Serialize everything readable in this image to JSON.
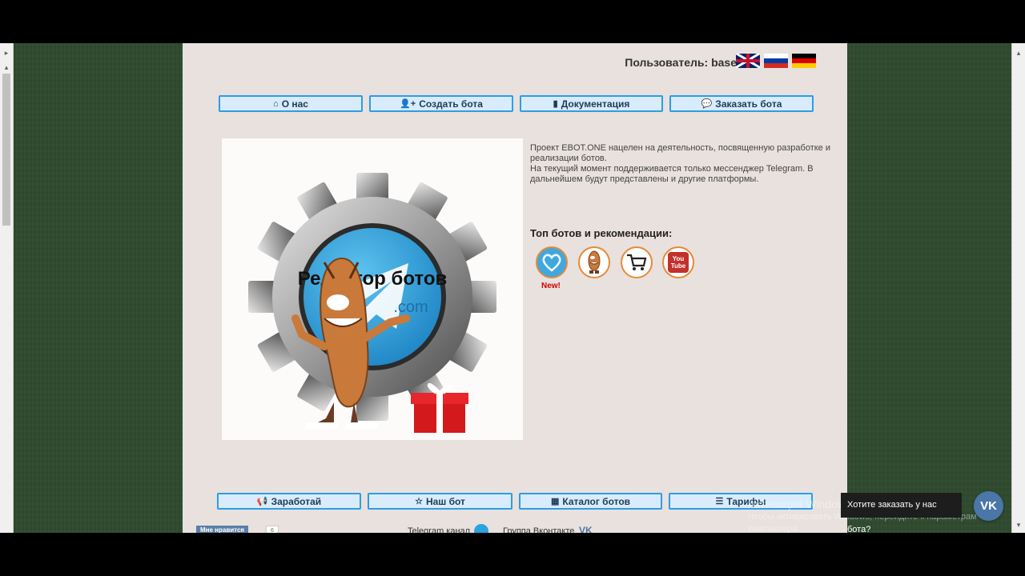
{
  "header": {
    "user_label": "Пользователь: base"
  },
  "nav_top": [
    {
      "label": "О нас",
      "icon": "home-icon"
    },
    {
      "label": "Создать бота",
      "icon": "user-plus-icon"
    },
    {
      "label": "Документация",
      "icon": "book-icon"
    },
    {
      "label": "Заказать бота",
      "icon": "chat-icon"
    }
  ],
  "hero": {
    "title": "Редактор ботов",
    "domain_text": ".com"
  },
  "intro": {
    "line1": "Проект EBOT.ONE нацелен на деятельность, посвященную разработке и реализации ботов.",
    "line2": "На текущий момент поддерживается только мессенджер Telegram. В дальнейшем будут представлены и другие платформы."
  },
  "top_bots": {
    "title": "Топ ботов и рекомендации:",
    "new_label": "New!",
    "icons": [
      "heart-message-icon",
      "mascot-icon",
      "shopping-cart-icon",
      "youtube-icon"
    ],
    "youtube_text": "You Tube"
  },
  "nav_bottom": [
    {
      "label": "Заработай",
      "icon": "megaphone-icon"
    },
    {
      "label": "Наш бот",
      "icon": "star-icon"
    },
    {
      "label": "Каталог ботов",
      "icon": "grid-icon"
    },
    {
      "label": "Тарифы",
      "icon": "sliders-icon"
    }
  ],
  "footer": {
    "like_label": "Мне нравится",
    "like_count": "6",
    "telegram_channel": "Telegram канал",
    "vk_group": "Группа Вконтакте"
  },
  "windows_watermark": {
    "line1": "Активация Windows",
    "line2": "Чтобы активировать Windows, перейдите к параметрам",
    "line3": "компьютера."
  },
  "order_prompt": {
    "text": "Хотите заказать у нас бота?",
    "vk_label": "VK"
  },
  "colors": {
    "button_border": "#2e9de6",
    "button_bg": "#d8ecfb",
    "page_bg": "#e8e1dd",
    "side_bg": "#2f4a2f",
    "accent_orange": "#e58a38"
  }
}
